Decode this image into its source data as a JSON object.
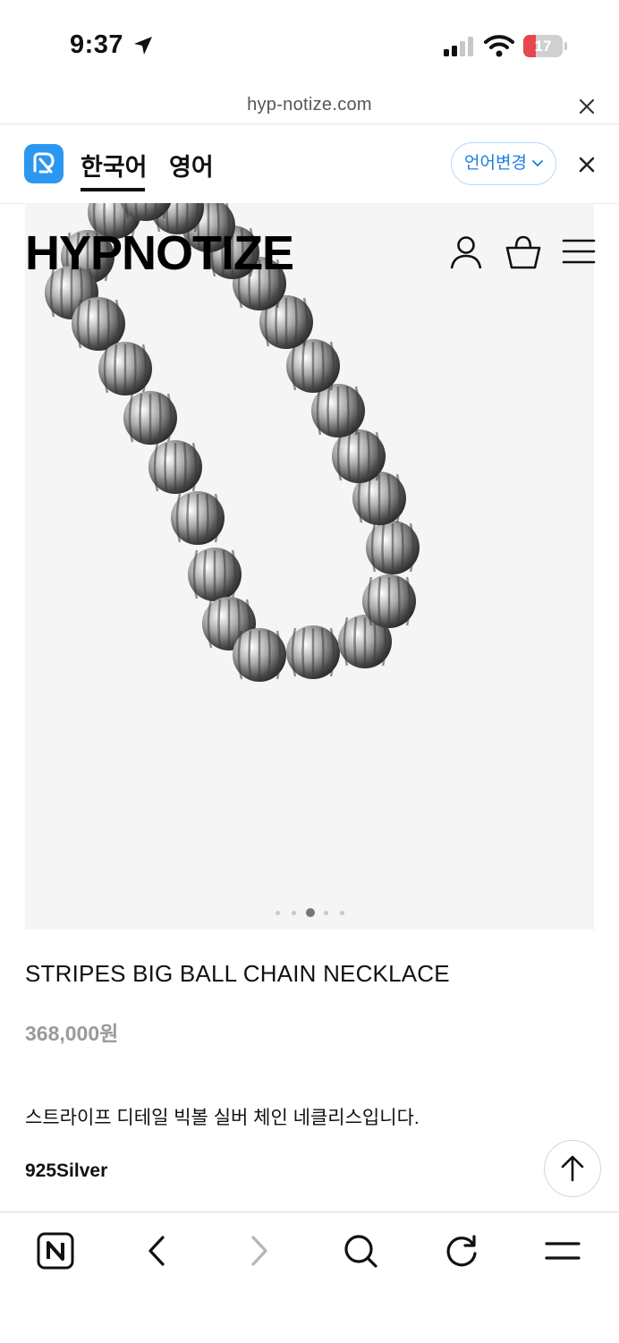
{
  "status_bar": {
    "time": "9:37",
    "battery": "17"
  },
  "browser": {
    "url": "hyp-notize.com"
  },
  "translate_bar": {
    "tabs": [
      {
        "label": "한국어",
        "active": true
      },
      {
        "label": "영어",
        "active": false
      }
    ],
    "change_language_label": "언어변경"
  },
  "site": {
    "logo": "HYPNOTIZE"
  },
  "product": {
    "name": "STRIPES BIG BALL CHAIN NECKLACE",
    "price": "368,000원",
    "description": "스트라이프 디테일 빅볼 실버 체인 네클리스입니다.",
    "material": "925Silver",
    "gallery": {
      "image_count": 5,
      "active_index": 2
    }
  },
  "icons": {
    "location": "location-arrow-icon",
    "signal": "cellular-signal-icon",
    "wifi": "wifi-icon",
    "close": "close-icon",
    "user": "user-icon",
    "bag": "shopping-bag-icon",
    "menu": "hamburger-menu-icon",
    "scroll_top": "arrow-up-icon",
    "naver": "naver-n-icon",
    "back": "chevron-left-icon",
    "forward": "chevron-right-icon",
    "search": "search-icon",
    "refresh": "refresh-icon",
    "more": "menu-icon"
  },
  "colors": {
    "accent_blue": "#1b7fe0",
    "papago_blue": "#2c97f0",
    "battery_red": "#e5484d",
    "price_gray": "#9a9a9a"
  }
}
